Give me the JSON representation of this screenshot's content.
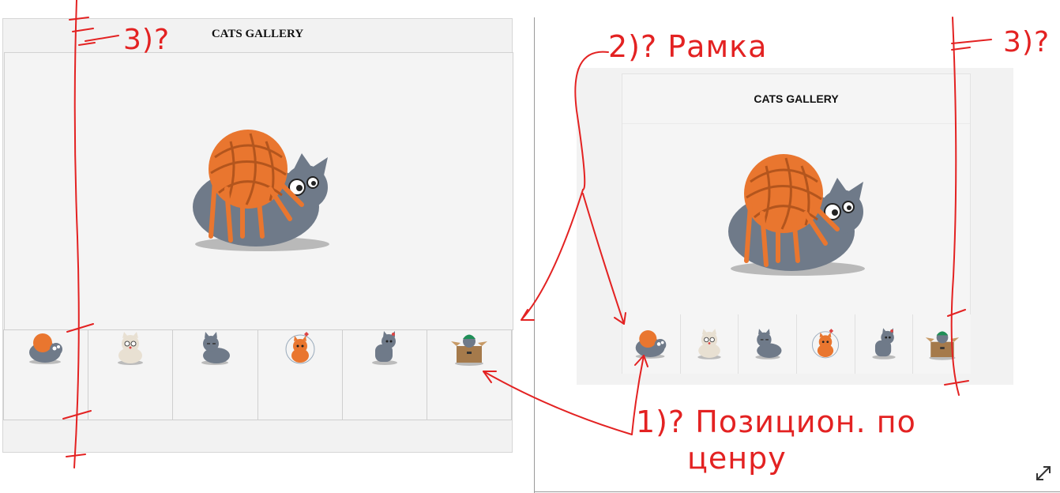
{
  "left_gallery": {
    "title": "CATS GALLERY",
    "main_image": "cat-yarn-ball",
    "thumbnails": [
      "cat-yarn-ball",
      "cat-cream-glasses",
      "cat-sleepy-gray",
      "cat-orange-bubble",
      "cat-gray-sitting",
      "cat-box-frog-hat"
    ]
  },
  "right_gallery": {
    "title": "CATS GALLERY",
    "main_image": "cat-yarn-ball",
    "thumbnails": [
      "cat-yarn-ball",
      "cat-cream-glasses",
      "cat-sleepy-gray",
      "cat-orange-bubble",
      "cat-gray-sitting",
      "cat-box-frog-hat"
    ]
  },
  "annotations": {
    "note_left_question": "3)?",
    "note_right_question": "3)?",
    "note_frame": "2)? Рамка",
    "note_center_line1": "1)? Позицион. по",
    "note_center_line2": "ценру"
  },
  "colors": {
    "annotation": "#e32222",
    "panel_bg": "#f2f2f2",
    "cat_gray": "#6f7a89",
    "yarn_orange": "#e9762f"
  },
  "icons": {
    "expand": "expand-icon"
  }
}
